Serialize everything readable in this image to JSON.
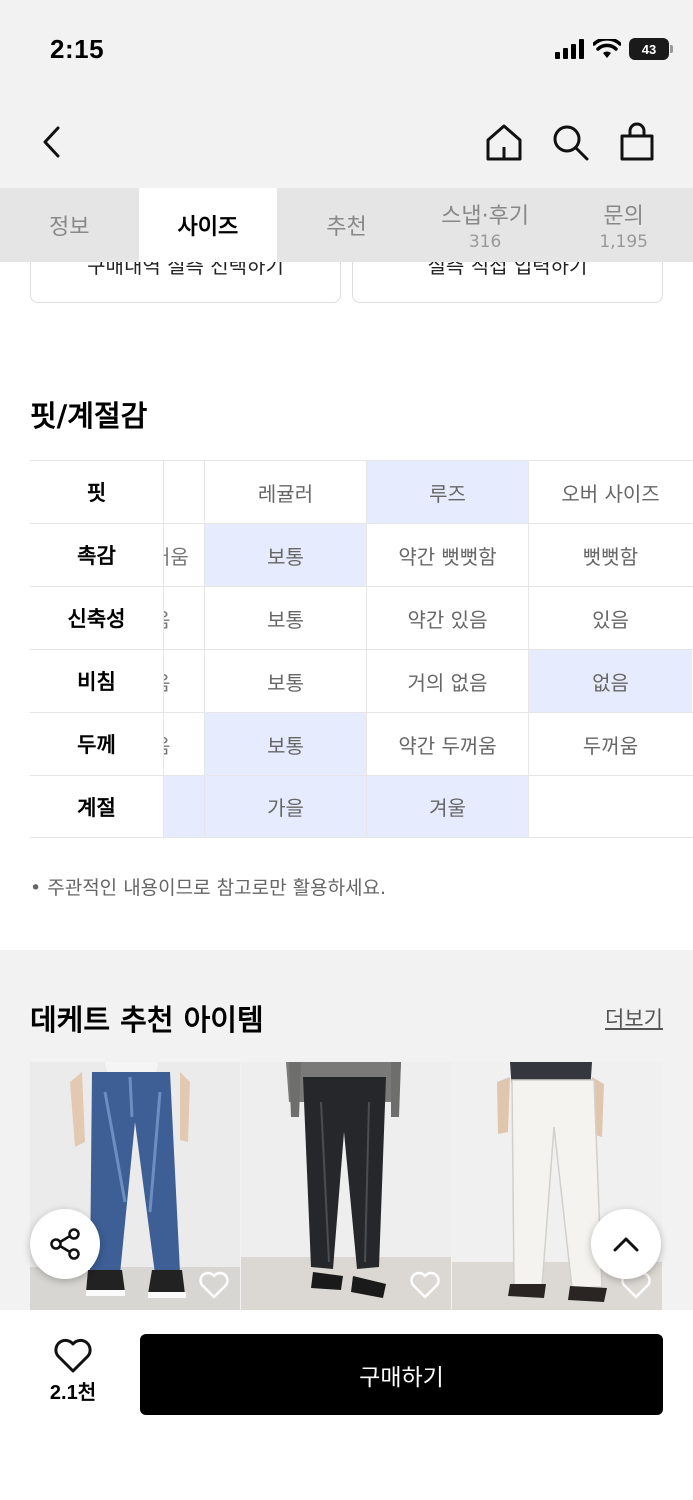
{
  "status": {
    "time": "2:15",
    "battery": "43"
  },
  "nav": {
    "back_icon": "chevron-left-icon",
    "home_icon": "home-icon",
    "search_icon": "search-icon",
    "cart_icon": "shopping-bag-icon"
  },
  "tabs": [
    {
      "label": "정보",
      "count": ""
    },
    {
      "label": "사이즈",
      "count": ""
    },
    {
      "label": "추천",
      "count": ""
    },
    {
      "label": "스냅·후기",
      "count": "316"
    },
    {
      "label": "문의",
      "count": "1,195"
    }
  ],
  "size_buttons": {
    "purchase_history": "구매내역 실측 선택하기",
    "direct_input": "실측 직접 입력하기"
  },
  "fit_section": {
    "title": "핏/계절감",
    "rows": [
      {
        "label": "핏",
        "clip": "",
        "cells": [
          "레귤러",
          "루즈",
          "오버 사이즈"
        ]
      },
      {
        "label": "촉감",
        "clip": "러움",
        "cells": [
          "보통",
          "약간 뻣뻣함",
          "뻣뻣함"
        ]
      },
      {
        "label": "신축성",
        "clip": "음",
        "cells": [
          "보통",
          "약간 있음",
          "있음"
        ]
      },
      {
        "label": "비침",
        "clip": "음",
        "cells": [
          "보통",
          "거의 없음",
          "없음"
        ]
      },
      {
        "label": "두께",
        "clip": "음",
        "cells": [
          "보통",
          "약간 두꺼움",
          "두꺼움"
        ]
      },
      {
        "label": "계절",
        "clip": "",
        "cells": [
          "가을",
          "겨울",
          ""
        ]
      }
    ],
    "note": "• 주관적인 내용이므로 참고로만 활용하세요."
  },
  "recommend": {
    "title": "데케트 추천 아이템",
    "more": "더보기"
  },
  "bottom": {
    "like_count": "2.1천",
    "buy_label": "구매하기"
  },
  "colors": {
    "selected": "#e6ecfd",
    "primary": "#000000"
  }
}
